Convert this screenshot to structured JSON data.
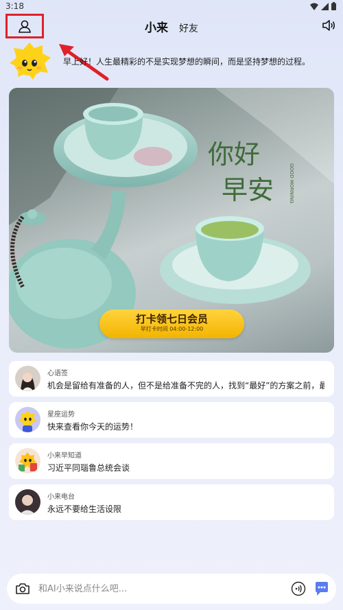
{
  "status_bar": {
    "time": "3:18"
  },
  "header": {
    "tab_active": "小来",
    "tab_friends": "好友"
  },
  "greeting": {
    "text": "早上好！人生最精彩的不是实现梦想的瞬间，而是坚持梦想的过程。"
  },
  "hero": {
    "calligraphy_top": "你好",
    "calligraphy_bottom": "早安",
    "english": "GOOD MORNING",
    "button_label": "打卡领七日会员",
    "button_sub": "早打卡时间 04:00-12:00"
  },
  "list": {
    "items": [
      {
        "category": "心语签",
        "text": "机会是留给有准备的人，但不是给准备不完的人，找到“最好”的方案之前，最"
      },
      {
        "category": "星座运势",
        "text": "快来查看你今天的运势！"
      },
      {
        "category": "小来早知道",
        "text": "习近平同瑙鲁总统会谈"
      },
      {
        "category": "小来电台",
        "text": "永远不要给生活设限"
      }
    ]
  },
  "input": {
    "placeholder": "和AI小来说点什么吧..."
  },
  "colors": {
    "accent_red": "#e0202a",
    "button_yellow": "#f3b400",
    "chat_blue": "#5b7cf0"
  },
  "icons": [
    "wifi-icon",
    "signal-icon",
    "battery-icon",
    "user-icon",
    "speaker-icon",
    "camera-icon",
    "voice-icon",
    "chat-icon"
  ]
}
